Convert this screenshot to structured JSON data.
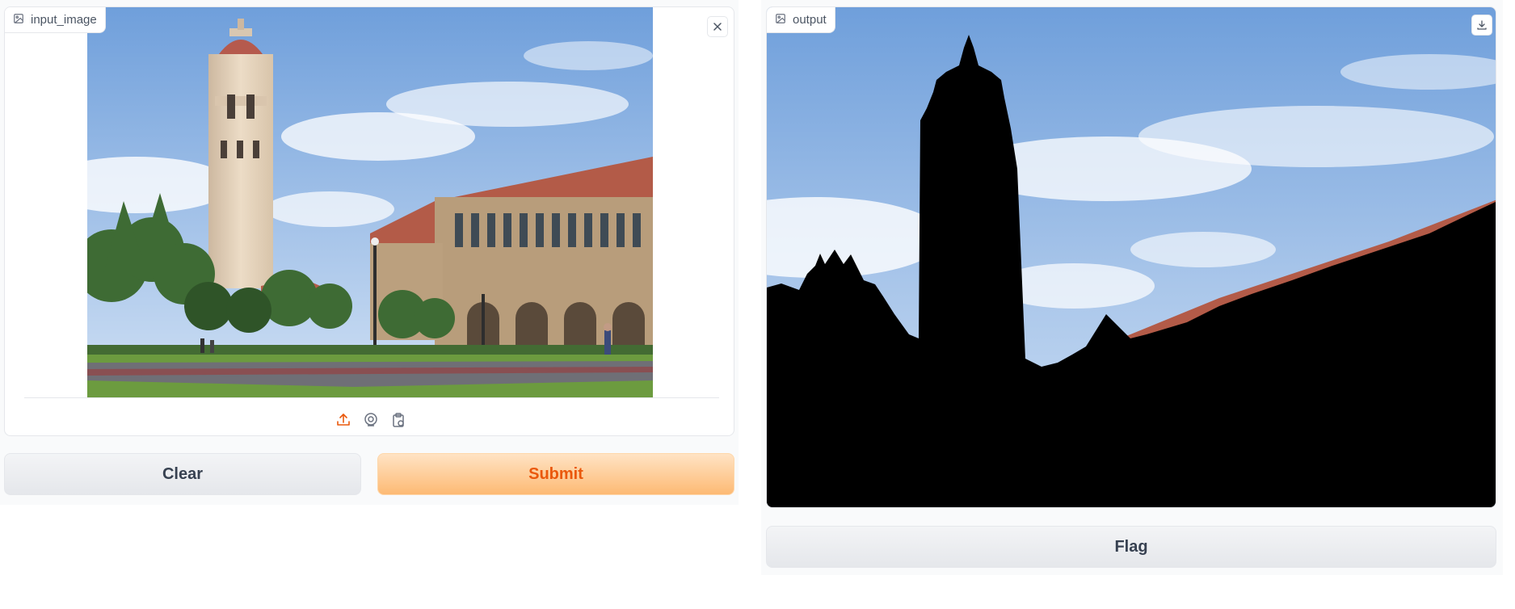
{
  "input": {
    "label": "input_image",
    "label_icon": "image-icon",
    "clear_icon": "close-icon",
    "sources": [
      {
        "icon": "upload-icon",
        "active": true
      },
      {
        "icon": "webcam-icon",
        "active": false
      },
      {
        "icon": "clipboard-icon",
        "active": false
      }
    ]
  },
  "output": {
    "label": "output",
    "label_icon": "image-icon",
    "download_icon": "download-icon"
  },
  "buttons": {
    "clear_label": "Clear",
    "submit_label": "Submit",
    "flag_label": "Flag"
  },
  "colors": {
    "accent": "#ea580c",
    "primary_button_from": "#ffe3c4",
    "primary_button_to": "#fdba74",
    "panel_border": "#e5e7eb"
  }
}
